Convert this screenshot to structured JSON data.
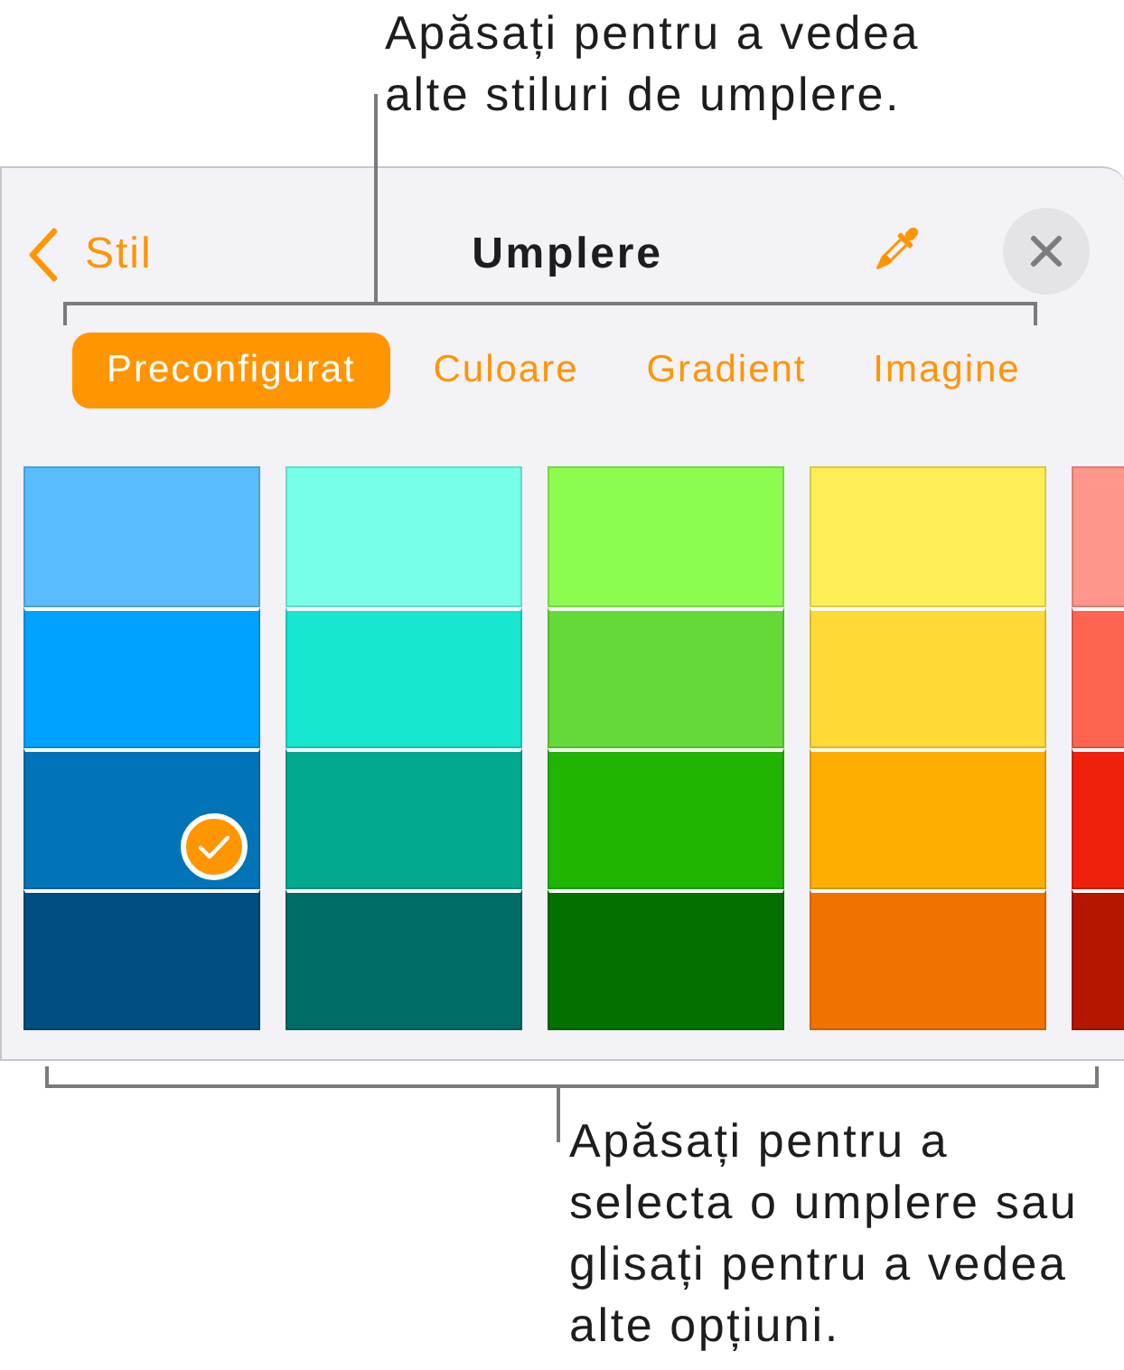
{
  "top_callout": {
    "text": "Apăsați pentru a vedea\nalte stiluri de umplere."
  },
  "panel": {
    "back_label": "Stil",
    "title": "Umplere",
    "tabs": [
      {
        "label": "Preconfigurat",
        "selected": true
      },
      {
        "label": "Culoare",
        "selected": false
      },
      {
        "label": "Gradient",
        "selected": false
      },
      {
        "label": "Imagine",
        "selected": false
      }
    ],
    "swatch_columns": [
      {
        "swatches": [
          {
            "color": "#5abdfe",
            "selected": false
          },
          {
            "color": "#00a2ff",
            "selected": false
          },
          {
            "color": "#0074b6",
            "selected": true
          },
          {
            "color": "#004d80",
            "selected": false
          }
        ]
      },
      {
        "swatches": [
          {
            "color": "#78ffe9",
            "selected": false
          },
          {
            "color": "#17e6d1",
            "selected": false
          },
          {
            "color": "#02a98f",
            "selected": false
          },
          {
            "color": "#016c65",
            "selected": false
          }
        ]
      },
      {
        "swatches": [
          {
            "color": "#8cfc4f",
            "selected": false
          },
          {
            "color": "#64da38",
            "selected": false
          },
          {
            "color": "#1fb502",
            "selected": false
          },
          {
            "color": "#027100",
            "selected": false
          }
        ]
      },
      {
        "swatches": [
          {
            "color": "#feee56",
            "selected": false
          },
          {
            "color": "#ffd935",
            "selected": false
          },
          {
            "color": "#feae00",
            "selected": false
          },
          {
            "color": "#f07300",
            "selected": false
          }
        ]
      },
      {
        "swatches": [
          {
            "color": "#ff958b",
            "selected": false
          },
          {
            "color": "#ff6451",
            "selected": false
          },
          {
            "color": "#ee220c",
            "selected": false
          },
          {
            "color": "#b41600",
            "selected": false
          }
        ]
      }
    ]
  },
  "bottom_callout": {
    "text": "Apăsați pentru a\nselecta o umplere sau\nglisați pentru a vedea\nalte opțiuni."
  }
}
